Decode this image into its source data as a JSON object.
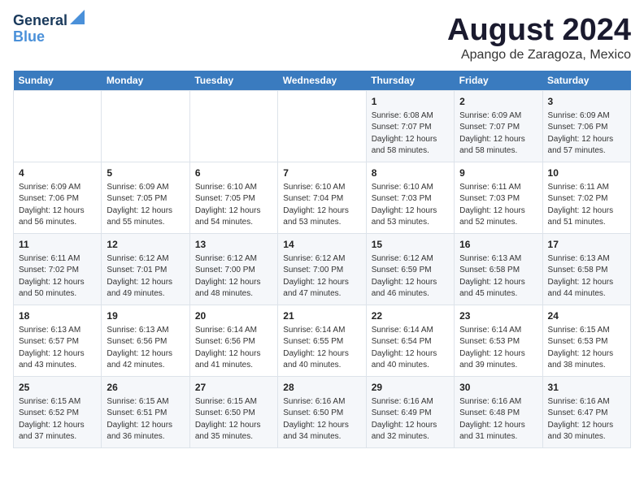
{
  "header": {
    "logo_line1": "General",
    "logo_line2": "Blue",
    "title": "August 2024",
    "subtitle": "Apango de Zaragoza, Mexico"
  },
  "days_of_week": [
    "Sunday",
    "Monday",
    "Tuesday",
    "Wednesday",
    "Thursday",
    "Friday",
    "Saturday"
  ],
  "weeks": [
    [
      {
        "day": "",
        "info": ""
      },
      {
        "day": "",
        "info": ""
      },
      {
        "day": "",
        "info": ""
      },
      {
        "day": "",
        "info": ""
      },
      {
        "day": "1",
        "info": "Sunrise: 6:08 AM\nSunset: 7:07 PM\nDaylight: 12 hours\nand 58 minutes."
      },
      {
        "day": "2",
        "info": "Sunrise: 6:09 AM\nSunset: 7:07 PM\nDaylight: 12 hours\nand 58 minutes."
      },
      {
        "day": "3",
        "info": "Sunrise: 6:09 AM\nSunset: 7:06 PM\nDaylight: 12 hours\nand 57 minutes."
      }
    ],
    [
      {
        "day": "4",
        "info": "Sunrise: 6:09 AM\nSunset: 7:06 PM\nDaylight: 12 hours\nand 56 minutes."
      },
      {
        "day": "5",
        "info": "Sunrise: 6:09 AM\nSunset: 7:05 PM\nDaylight: 12 hours\nand 55 minutes."
      },
      {
        "day": "6",
        "info": "Sunrise: 6:10 AM\nSunset: 7:05 PM\nDaylight: 12 hours\nand 54 minutes."
      },
      {
        "day": "7",
        "info": "Sunrise: 6:10 AM\nSunset: 7:04 PM\nDaylight: 12 hours\nand 53 minutes."
      },
      {
        "day": "8",
        "info": "Sunrise: 6:10 AM\nSunset: 7:03 PM\nDaylight: 12 hours\nand 53 minutes."
      },
      {
        "day": "9",
        "info": "Sunrise: 6:11 AM\nSunset: 7:03 PM\nDaylight: 12 hours\nand 52 minutes."
      },
      {
        "day": "10",
        "info": "Sunrise: 6:11 AM\nSunset: 7:02 PM\nDaylight: 12 hours\nand 51 minutes."
      }
    ],
    [
      {
        "day": "11",
        "info": "Sunrise: 6:11 AM\nSunset: 7:02 PM\nDaylight: 12 hours\nand 50 minutes."
      },
      {
        "day": "12",
        "info": "Sunrise: 6:12 AM\nSunset: 7:01 PM\nDaylight: 12 hours\nand 49 minutes."
      },
      {
        "day": "13",
        "info": "Sunrise: 6:12 AM\nSunset: 7:00 PM\nDaylight: 12 hours\nand 48 minutes."
      },
      {
        "day": "14",
        "info": "Sunrise: 6:12 AM\nSunset: 7:00 PM\nDaylight: 12 hours\nand 47 minutes."
      },
      {
        "day": "15",
        "info": "Sunrise: 6:12 AM\nSunset: 6:59 PM\nDaylight: 12 hours\nand 46 minutes."
      },
      {
        "day": "16",
        "info": "Sunrise: 6:13 AM\nSunset: 6:58 PM\nDaylight: 12 hours\nand 45 minutes."
      },
      {
        "day": "17",
        "info": "Sunrise: 6:13 AM\nSunset: 6:58 PM\nDaylight: 12 hours\nand 44 minutes."
      }
    ],
    [
      {
        "day": "18",
        "info": "Sunrise: 6:13 AM\nSunset: 6:57 PM\nDaylight: 12 hours\nand 43 minutes."
      },
      {
        "day": "19",
        "info": "Sunrise: 6:13 AM\nSunset: 6:56 PM\nDaylight: 12 hours\nand 42 minutes."
      },
      {
        "day": "20",
        "info": "Sunrise: 6:14 AM\nSunset: 6:56 PM\nDaylight: 12 hours\nand 41 minutes."
      },
      {
        "day": "21",
        "info": "Sunrise: 6:14 AM\nSunset: 6:55 PM\nDaylight: 12 hours\nand 40 minutes."
      },
      {
        "day": "22",
        "info": "Sunrise: 6:14 AM\nSunset: 6:54 PM\nDaylight: 12 hours\nand 40 minutes."
      },
      {
        "day": "23",
        "info": "Sunrise: 6:14 AM\nSunset: 6:53 PM\nDaylight: 12 hours\nand 39 minutes."
      },
      {
        "day": "24",
        "info": "Sunrise: 6:15 AM\nSunset: 6:53 PM\nDaylight: 12 hours\nand 38 minutes."
      }
    ],
    [
      {
        "day": "25",
        "info": "Sunrise: 6:15 AM\nSunset: 6:52 PM\nDaylight: 12 hours\nand 37 minutes."
      },
      {
        "day": "26",
        "info": "Sunrise: 6:15 AM\nSunset: 6:51 PM\nDaylight: 12 hours\nand 36 minutes."
      },
      {
        "day": "27",
        "info": "Sunrise: 6:15 AM\nSunset: 6:50 PM\nDaylight: 12 hours\nand 35 minutes."
      },
      {
        "day": "28",
        "info": "Sunrise: 6:16 AM\nSunset: 6:50 PM\nDaylight: 12 hours\nand 34 minutes."
      },
      {
        "day": "29",
        "info": "Sunrise: 6:16 AM\nSunset: 6:49 PM\nDaylight: 12 hours\nand 32 minutes."
      },
      {
        "day": "30",
        "info": "Sunrise: 6:16 AM\nSunset: 6:48 PM\nDaylight: 12 hours\nand 31 minutes."
      },
      {
        "day": "31",
        "info": "Sunrise: 6:16 AM\nSunset: 6:47 PM\nDaylight: 12 hours\nand 30 minutes."
      }
    ]
  ]
}
